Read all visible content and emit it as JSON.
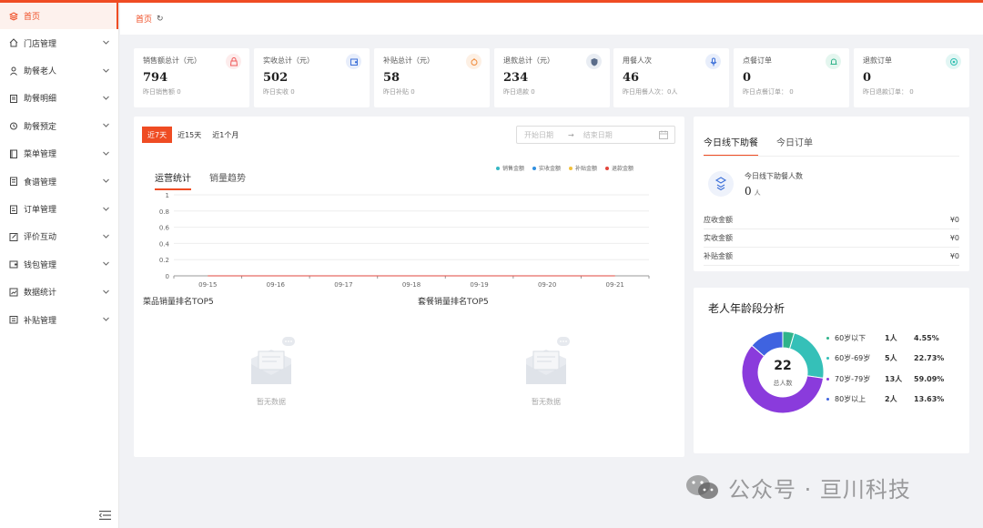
{
  "colors": {
    "accent": "#ef4c23"
  },
  "sidebar": {
    "items": [
      {
        "label": "首页",
        "icon": "layers-icon",
        "active": true
      },
      {
        "label": "门店管理",
        "icon": "home-icon"
      },
      {
        "label": "助餐老人",
        "icon": "person-icon"
      },
      {
        "label": "助餐明细",
        "icon": "clipboard-icon"
      },
      {
        "label": "助餐预定",
        "icon": "alarm-icon"
      },
      {
        "label": "菜单管理",
        "icon": "book-icon"
      },
      {
        "label": "食谱管理",
        "icon": "recipe-icon"
      },
      {
        "label": "订单管理",
        "icon": "order-icon"
      },
      {
        "label": "评价互动",
        "icon": "edit-icon"
      },
      {
        "label": "钱包管理",
        "icon": "wallet-icon"
      },
      {
        "label": "数据统计",
        "icon": "chart-icon"
      },
      {
        "label": "补贴管理",
        "icon": "list-icon"
      }
    ]
  },
  "breadcrumb": {
    "current": "首页",
    "refresh_glyph": "↻"
  },
  "stats": [
    {
      "title": "销售额总计（元）",
      "value": "794",
      "sub": "昨日销售额 0",
      "icon": "bag-icon",
      "color": "#f05a5a",
      "bg": "#fdecec"
    },
    {
      "title": "实收总计（元）",
      "value": "502",
      "sub": "昨日实收 0",
      "icon": "wallet-icon",
      "color": "#3b6fd8",
      "bg": "#e8eefb"
    },
    {
      "title": "补贴总计（元）",
      "value": "58",
      "sub": "昨日补贴 0",
      "icon": "gift-icon",
      "color": "#f08a3a",
      "bg": "#fdf0e4"
    },
    {
      "title": "退款总计（元）",
      "value": "234",
      "sub": "昨日退款 0",
      "icon": "shield-icon",
      "color": "#5a6c8a",
      "bg": "#e9edf3"
    },
    {
      "title": "用餐人次",
      "value": "46",
      "sub": "昨日用餐人次：0人",
      "icon": "mic-icon",
      "color": "#3b6fd8",
      "bg": "#e8eefb"
    },
    {
      "title": "点餐订单",
      "value": "0",
      "sub": "昨日点餐订单： 0",
      "icon": "bell-icon",
      "color": "#2fb38a",
      "bg": "#e4f6ef"
    },
    {
      "title": "退款订单",
      "value": "0",
      "sub": "昨日退款订单： 0",
      "icon": "target-icon",
      "color": "#2fbfb0",
      "bg": "#e2f6f4"
    }
  ],
  "main": {
    "ranges": [
      "近7天",
      "近15天",
      "近1个月"
    ],
    "date_start_placeholder": "开始日期",
    "date_arrow": "→",
    "date_end_placeholder": "结束日期",
    "tabs": [
      "运营统计",
      "销量趋势"
    ],
    "rank_dish_title": "菜品销量排名TOP5",
    "rank_combo_title": "套餐销量排名TOP5",
    "empty_text": "暂无数据"
  },
  "chart_data": {
    "type": "line",
    "x": [
      "09-15",
      "09-16",
      "09-17",
      "09-18",
      "09-19",
      "09-20",
      "09-21"
    ],
    "yticks": [
      "0",
      "0.2",
      "0.4",
      "0.6",
      "0.8",
      "1"
    ],
    "ylim": [
      0,
      1
    ],
    "series": [
      {
        "name": "销售金额",
        "color": "#35b7c4",
        "values": [
          0,
          0,
          0,
          0,
          0,
          0,
          0
        ]
      },
      {
        "name": "实收金额",
        "color": "#2f8fe0",
        "values": [
          0,
          0,
          0,
          0,
          0,
          0,
          0
        ]
      },
      {
        "name": "补贴金额",
        "color": "#f2c13c",
        "values": [
          0,
          0,
          0,
          0,
          0,
          0,
          0
        ]
      },
      {
        "name": "退款金额",
        "color": "#e2463c",
        "values": [
          0,
          0,
          0,
          0,
          0,
          0,
          0
        ]
      }
    ],
    "grid": true,
    "legend": "top-right"
  },
  "today": {
    "tabs": [
      "今日线下助餐",
      "今日订单"
    ],
    "label": "今日线下助餐人数",
    "count": "0",
    "unit": "人",
    "rows": [
      {
        "label": "应收金额",
        "value": "¥0"
      },
      {
        "label": "实收金额",
        "value": "¥0"
      },
      {
        "label": "补贴金额",
        "value": "¥0"
      }
    ]
  },
  "age": {
    "title": "老人年龄段分析",
    "total": "22",
    "total_label": "总人数",
    "groups": [
      {
        "label": "60岁以下",
        "count": "1人",
        "pct": "4.55%",
        "value": 1,
        "color": "#2fb38a"
      },
      {
        "label": "60岁-69岁",
        "count": "5人",
        "pct": "22.73%",
        "value": 5,
        "color": "#35c0b8"
      },
      {
        "label": "70岁-79岁",
        "count": "13人",
        "pct": "59.09%",
        "value": 13,
        "color": "#8a3bdc"
      },
      {
        "label": "80岁以上",
        "count": "2人",
        "pct": "13.63%",
        "value": 3,
        "color": "#3f63e0"
      }
    ]
  },
  "watermark": {
    "text": "公众号 · 亘川科技"
  }
}
